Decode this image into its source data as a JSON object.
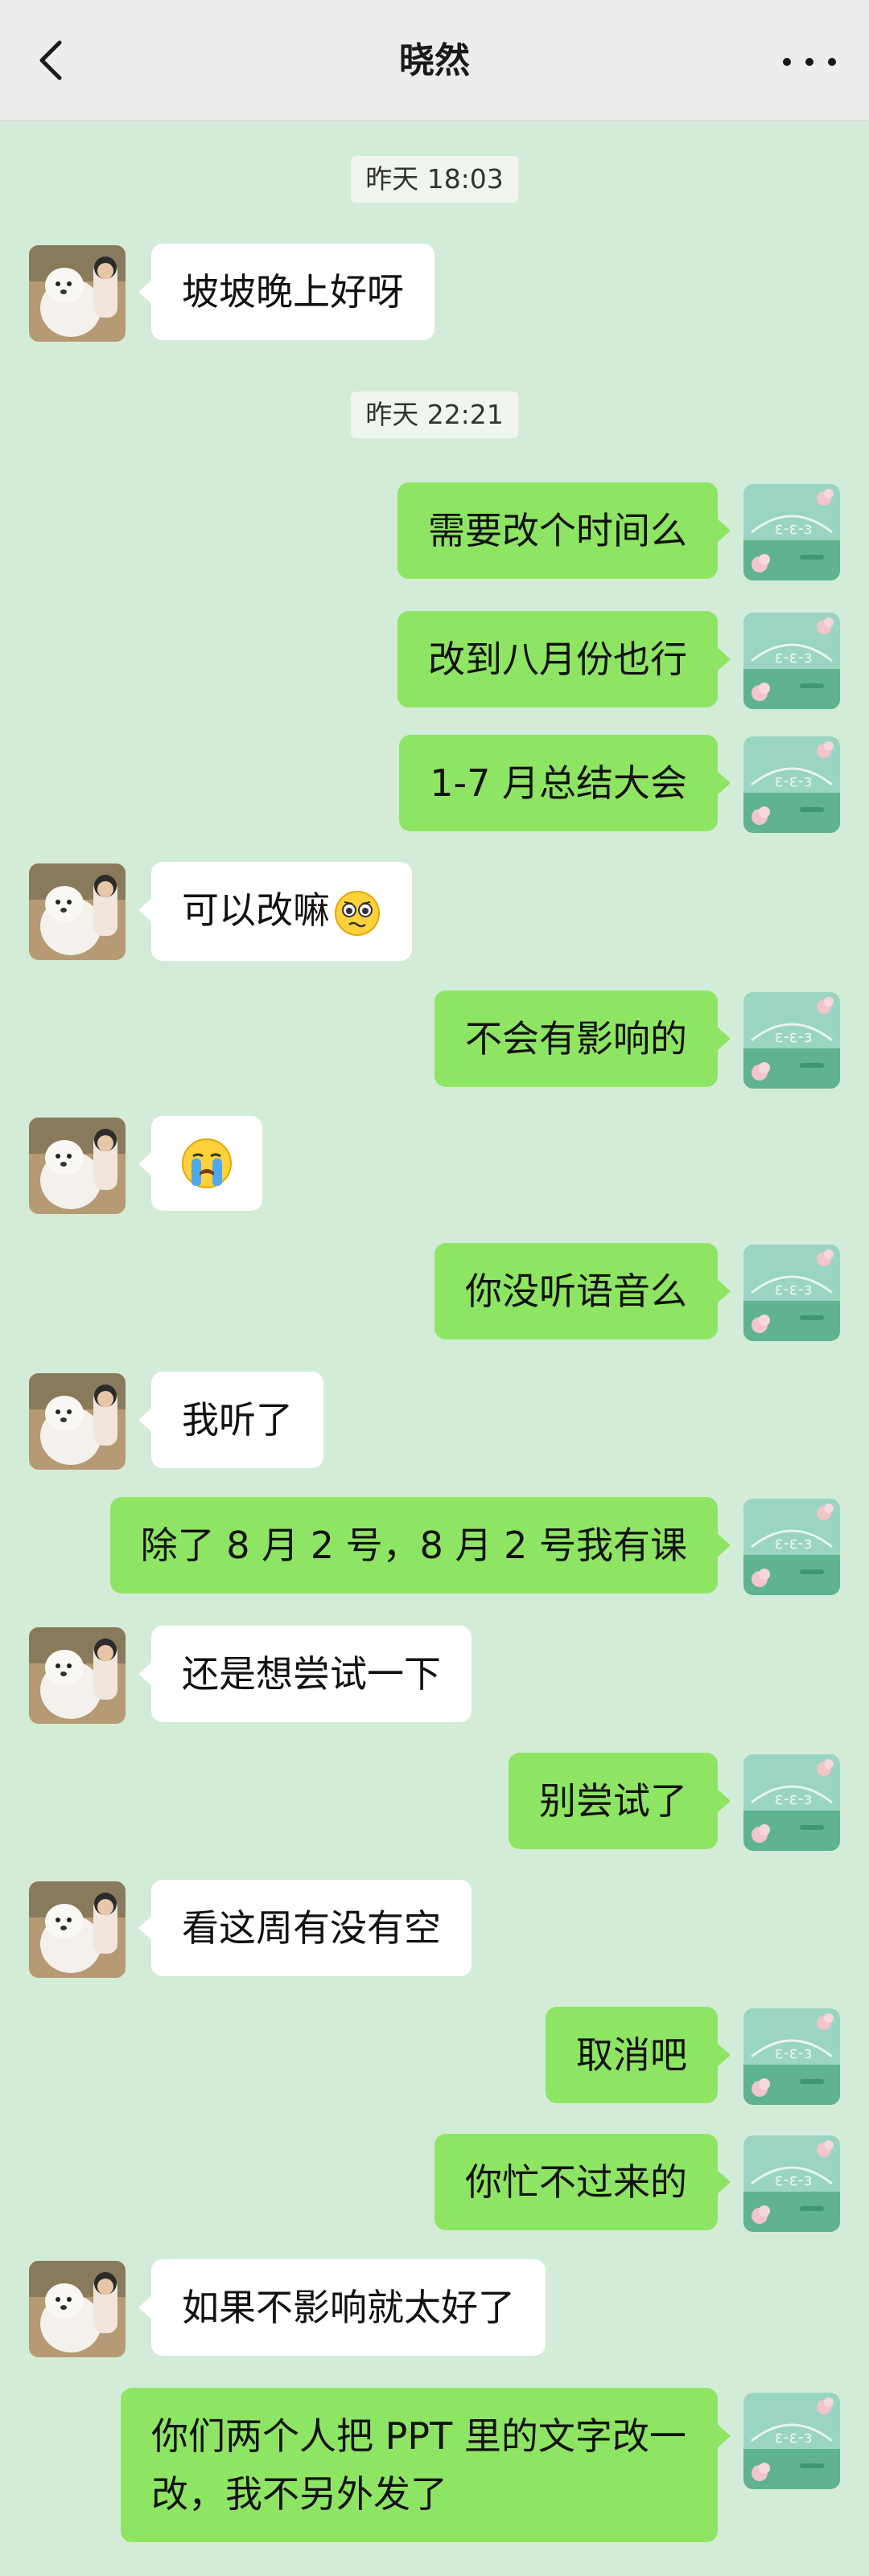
{
  "header": {
    "title": "晓然"
  },
  "messages": [
    {
      "kind": "time",
      "text": "昨天 18:03"
    },
    {
      "kind": "in",
      "text": "坡坡晚上好呀"
    },
    {
      "kind": "time",
      "text": "昨天 22:21"
    },
    {
      "kind": "out",
      "text": "需要改个时间么"
    },
    {
      "kind": "out",
      "text": "改到八月份也行"
    },
    {
      "kind": "out",
      "text": "1-7 月总结大会"
    },
    {
      "kind": "in",
      "text": "可以改嘛",
      "emoji": "nervous-face-emoji"
    },
    {
      "kind": "out",
      "text": "不会有影响的"
    },
    {
      "kind": "in",
      "emoji": "crying-face-emoji"
    },
    {
      "kind": "out",
      "text": "你没听语音么"
    },
    {
      "kind": "in",
      "text": "我听了"
    },
    {
      "kind": "out",
      "text": "除了 8 月 2 号，8 月 2 号我有课"
    },
    {
      "kind": "in",
      "text": "还是想尝试一下"
    },
    {
      "kind": "out",
      "text": "别尝试了"
    },
    {
      "kind": "in",
      "text": "看这周有没有空"
    },
    {
      "kind": "out",
      "text": "取消吧"
    },
    {
      "kind": "out",
      "text": "你忙不过来的"
    },
    {
      "kind": "in",
      "text": "如果不影响就太好了"
    },
    {
      "kind": "out",
      "text": "你们两个人把 PPT 里的文字改一改，我不另外发了"
    }
  ],
  "colors": {
    "chat_background": "#d3ecd8",
    "outgoing_bubble": "#8ee563",
    "incoming_bubble": "#ffffff",
    "header_background": "#ededed"
  }
}
